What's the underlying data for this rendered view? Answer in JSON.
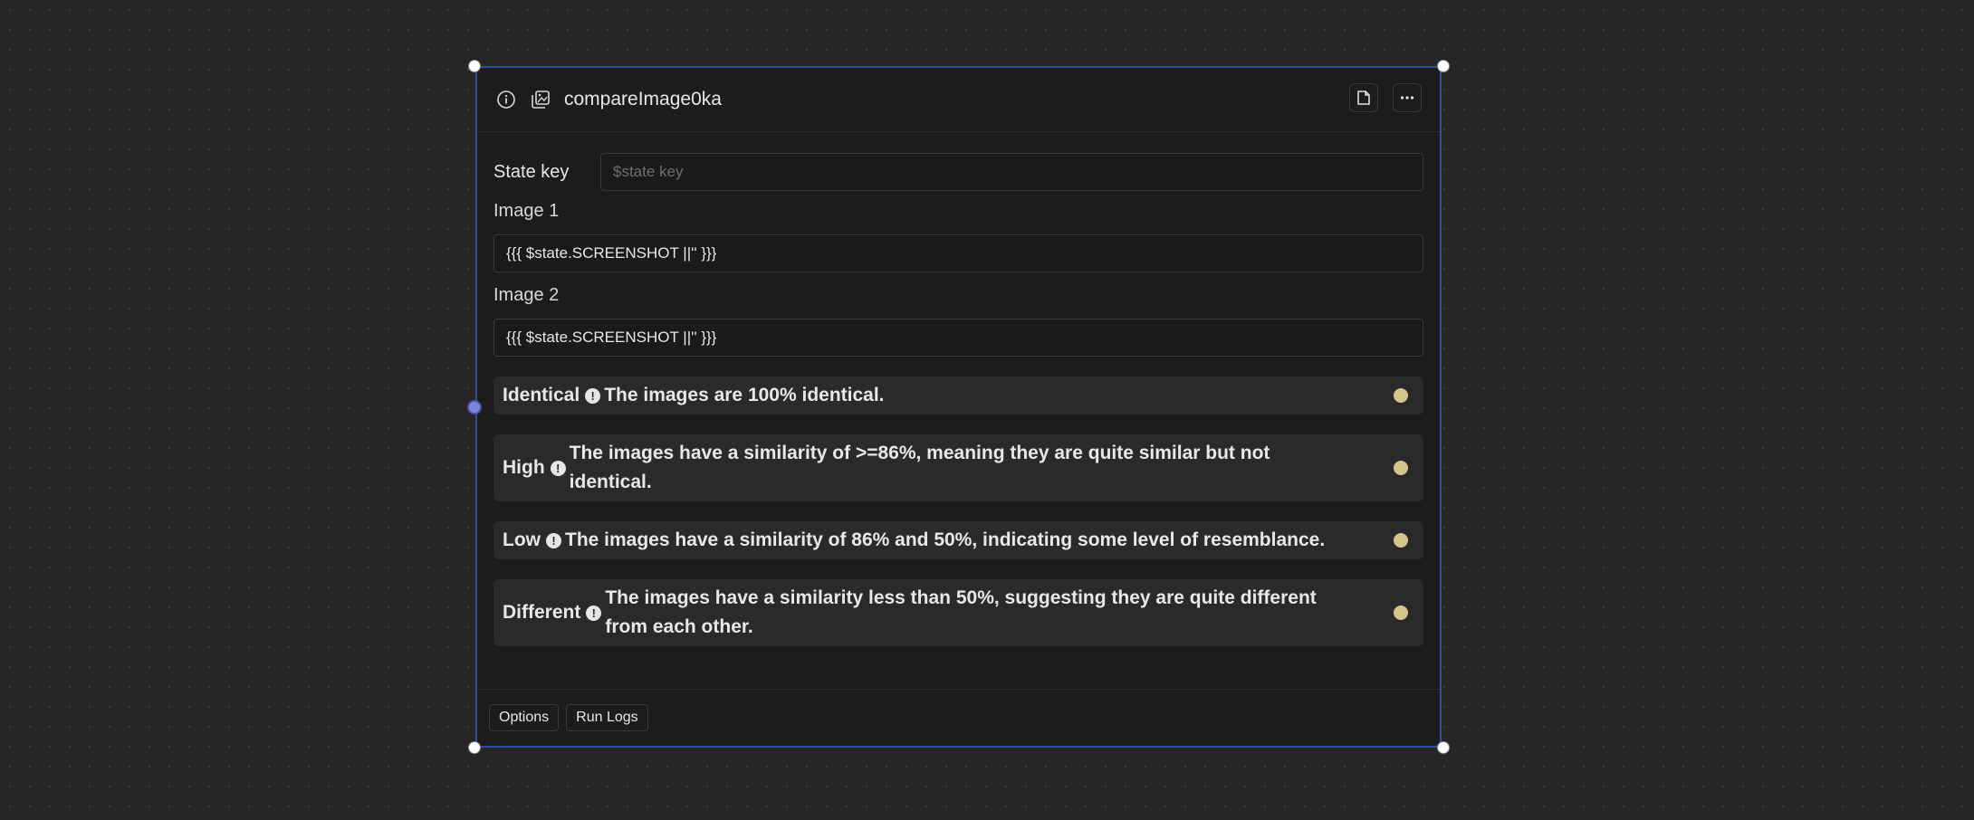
{
  "node": {
    "title": "compareImage0ka",
    "header_icons": [
      "info-icon",
      "image-compare-icon"
    ],
    "actions": [
      "document-icon",
      "more-icon"
    ]
  },
  "fields": {
    "state_key": {
      "label": "State key",
      "placeholder": "$state key"
    },
    "image1": {
      "label": "Image 1",
      "value": "{{{ $state.SCREENSHOT ||'' }}}"
    },
    "image2": {
      "label": "Image 2",
      "value": "{{{ $state.SCREENSHOT ||'' }}}"
    }
  },
  "outcomes": [
    {
      "name": "Identical",
      "desc": "The images are 100% identical."
    },
    {
      "name": "High",
      "desc": "The images have a similarity of >=86%, meaning they are quite similar but not identical."
    },
    {
      "name": "Low",
      "desc": "The images have a similarity of 86% and 50%, indicating some level of resemblance."
    },
    {
      "name": "Different",
      "desc": "The images have a similarity less than 50%, suggesting they are quite different from each other."
    }
  ],
  "footer": {
    "options_label": "Options",
    "run_logs_label": "Run Logs"
  },
  "colors": {
    "selection_border": "#2f4f9e",
    "outcome_dot": "#d4c58c",
    "input_port": "#7b86d6"
  }
}
